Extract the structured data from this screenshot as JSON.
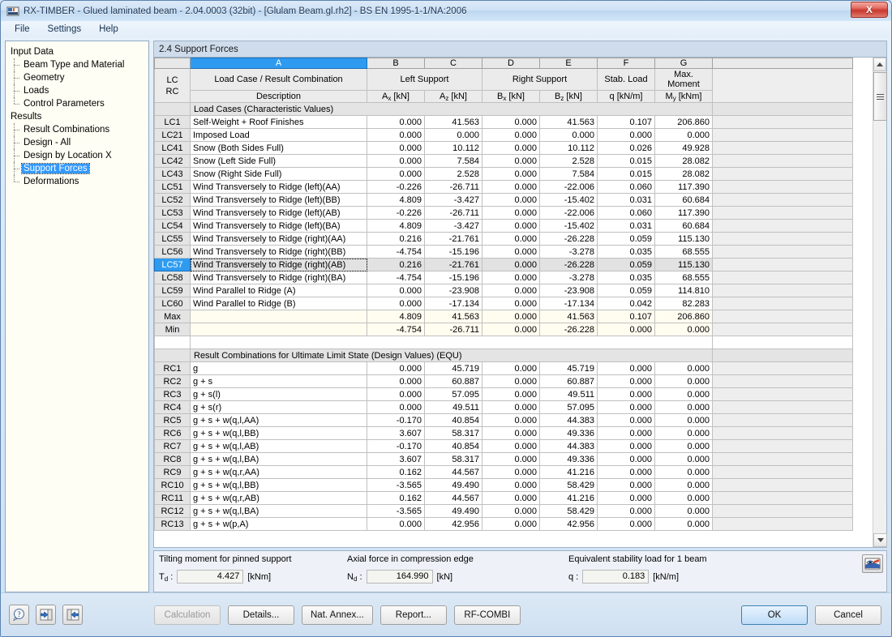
{
  "window": {
    "title": "RX-TIMBER - Glued laminated beam - 2.04.0003 (32bit) - [Glulam Beam.gl.rh2] - BS EN 1995-1-1/NA:2006",
    "close_label": "X"
  },
  "menubar": {
    "items": [
      "File",
      "Settings",
      "Help"
    ]
  },
  "sidebar": {
    "groups": [
      {
        "label": "Input Data",
        "children": [
          {
            "label": "Beam Type and Material",
            "selected": false
          },
          {
            "label": "Geometry",
            "selected": false
          },
          {
            "label": "Loads",
            "selected": false
          },
          {
            "label": "Control Parameters",
            "selected": false
          }
        ]
      },
      {
        "label": "Results",
        "children": [
          {
            "label": "Result Combinations",
            "selected": false
          },
          {
            "label": "Design - All",
            "selected": false
          },
          {
            "label": "Design by Location X",
            "selected": false
          },
          {
            "label": "Support Forces",
            "selected": true
          },
          {
            "label": "Deformations",
            "selected": false
          }
        ]
      }
    ]
  },
  "panel": {
    "header": "2.4 Support Forces"
  },
  "table": {
    "column_letters": [
      "",
      "A",
      "B",
      "C",
      "D",
      "E",
      "F",
      "G",
      ""
    ],
    "selected_column_letter": "A",
    "corner_header": {
      "line1": "LC",
      "line2": "RC"
    },
    "headers": [
      {
        "group": "Load Case / Result Combination",
        "unit": "Description"
      },
      {
        "group": "Left Support",
        "unit": "A<sub>x</sub> [kN]"
      },
      {
        "group": "",
        "unit": "A<sub>z</sub> [kN]"
      },
      {
        "group": "Right Support",
        "unit": "B<sub>x</sub> [kN]"
      },
      {
        "group": "",
        "unit": "B<sub>z</sub> [kN]"
      },
      {
        "group": "Stab. Load",
        "unit": "q [kN/m]"
      },
      {
        "group": "Max. Moment",
        "unit": "M<sub>y</sub> [kNm]"
      }
    ],
    "section1_title": "Load Cases (Characteristic Values)",
    "section2_title": "Result Combinations for Ultimate Limit State (Design Values) (EQU)",
    "selected_row_id": "LC57",
    "load_cases": [
      {
        "id": "LC1",
        "desc": "Self-Weight + Roof Finishes",
        "ax": "0.000",
        "az": "41.563",
        "bx": "0.000",
        "bz": "41.563",
        "q": "0.107",
        "my": "206.860"
      },
      {
        "id": "LC21",
        "desc": "Imposed Load",
        "ax": "0.000",
        "az": "0.000",
        "bx": "0.000",
        "bz": "0.000",
        "q": "0.000",
        "my": "0.000"
      },
      {
        "id": "LC41",
        "desc": "Snow (Both Sides Full)",
        "ax": "0.000",
        "az": "10.112",
        "bx": "0.000",
        "bz": "10.112",
        "q": "0.026",
        "my": "49.928"
      },
      {
        "id": "LC42",
        "desc": "Snow (Left Side Full)",
        "ax": "0.000",
        "az": "7.584",
        "bx": "0.000",
        "bz": "2.528",
        "q": "0.015",
        "my": "28.082"
      },
      {
        "id": "LC43",
        "desc": "Snow (Right Side Full)",
        "ax": "0.000",
        "az": "2.528",
        "bx": "0.000",
        "bz": "7.584",
        "q": "0.015",
        "my": "28.082"
      },
      {
        "id": "LC51",
        "desc": "Wind Transversely to Ridge (left)(AA)",
        "ax": "-0.226",
        "az": "-26.711",
        "bx": "0.000",
        "bz": "-22.006",
        "q": "0.060",
        "my": "117.390"
      },
      {
        "id": "LC52",
        "desc": "Wind Transversely to Ridge (left)(BB)",
        "ax": "4.809",
        "az": "-3.427",
        "bx": "0.000",
        "bz": "-15.402",
        "q": "0.031",
        "my": "60.684"
      },
      {
        "id": "LC53",
        "desc": "Wind Transversely to Ridge (left)(AB)",
        "ax": "-0.226",
        "az": "-26.711",
        "bx": "0.000",
        "bz": "-22.006",
        "q": "0.060",
        "my": "117.390"
      },
      {
        "id": "LC54",
        "desc": "Wind Transversely to Ridge (left)(BA)",
        "ax": "4.809",
        "az": "-3.427",
        "bx": "0.000",
        "bz": "-15.402",
        "q": "0.031",
        "my": "60.684"
      },
      {
        "id": "LC55",
        "desc": "Wind Transversely to Ridge (right)(AA)",
        "ax": "0.216",
        "az": "-21.761",
        "bx": "0.000",
        "bz": "-26.228",
        "q": "0.059",
        "my": "115.130"
      },
      {
        "id": "LC56",
        "desc": "Wind Transversely to Ridge (right)(BB)",
        "ax": "-4.754",
        "az": "-15.196",
        "bx": "0.000",
        "bz": "-3.278",
        "q": "0.035",
        "my": "68.555"
      },
      {
        "id": "LC57",
        "desc": "Wind Transversely to Ridge (right)(AB)",
        "ax": "0.216",
        "az": "-21.761",
        "bx": "0.000",
        "bz": "-26.228",
        "q": "0.059",
        "my": "115.130"
      },
      {
        "id": "LC58",
        "desc": "Wind Transversely to Ridge (right)(BA)",
        "ax": "-4.754",
        "az": "-15.196",
        "bx": "0.000",
        "bz": "-3.278",
        "q": "0.035",
        "my": "68.555"
      },
      {
        "id": "LC59",
        "desc": "Wind Parallel to Ridge (A)",
        "ax": "0.000",
        "az": "-23.908",
        "bx": "0.000",
        "bz": "-23.908",
        "q": "0.059",
        "my": "114.810"
      },
      {
        "id": "LC60",
        "desc": "Wind Parallel to Ridge (B)",
        "ax": "0.000",
        "az": "-17.134",
        "bx": "0.000",
        "bz": "-17.134",
        "q": "0.042",
        "my": "82.283"
      }
    ],
    "summary": [
      {
        "id": "Max",
        "desc": "",
        "ax": "4.809",
        "az": "41.563",
        "bx": "0.000",
        "bz": "41.563",
        "q": "0.107",
        "my": "206.860"
      },
      {
        "id": "Min",
        "desc": "",
        "ax": "-4.754",
        "az": "-26.711",
        "bx": "0.000",
        "bz": "-26.228",
        "q": "0.000",
        "my": "0.000"
      }
    ],
    "result_combinations": [
      {
        "id": "RC1",
        "desc": "g",
        "ax": "0.000",
        "az": "45.719",
        "bx": "0.000",
        "bz": "45.719",
        "q": "0.000",
        "my": "0.000"
      },
      {
        "id": "RC2",
        "desc": "g + s",
        "ax": "0.000",
        "az": "60.887",
        "bx": "0.000",
        "bz": "60.887",
        "q": "0.000",
        "my": "0.000"
      },
      {
        "id": "RC3",
        "desc": "g + s(l)",
        "ax": "0.000",
        "az": "57.095",
        "bx": "0.000",
        "bz": "49.511",
        "q": "0.000",
        "my": "0.000"
      },
      {
        "id": "RC4",
        "desc": "g + s(r)",
        "ax": "0.000",
        "az": "49.511",
        "bx": "0.000",
        "bz": "57.095",
        "q": "0.000",
        "my": "0.000"
      },
      {
        "id": "RC5",
        "desc": "g + s + w(q,l,AA)",
        "ax": "-0.170",
        "az": "40.854",
        "bx": "0.000",
        "bz": "44.383",
        "q": "0.000",
        "my": "0.000"
      },
      {
        "id": "RC6",
        "desc": "g + s + w(q,l,BB)",
        "ax": "3.607",
        "az": "58.317",
        "bx": "0.000",
        "bz": "49.336",
        "q": "0.000",
        "my": "0.000"
      },
      {
        "id": "RC7",
        "desc": "g + s + w(q,l,AB)",
        "ax": "-0.170",
        "az": "40.854",
        "bx": "0.000",
        "bz": "44.383",
        "q": "0.000",
        "my": "0.000"
      },
      {
        "id": "RC8",
        "desc": "g + s + w(q,l,BA)",
        "ax": "3.607",
        "az": "58.317",
        "bx": "0.000",
        "bz": "49.336",
        "q": "0.000",
        "my": "0.000"
      },
      {
        "id": "RC9",
        "desc": "g + s + w(q,r,AA)",
        "ax": "0.162",
        "az": "44.567",
        "bx": "0.000",
        "bz": "41.216",
        "q": "0.000",
        "my": "0.000"
      },
      {
        "id": "RC10",
        "desc": "g + s + w(q,l,BB)",
        "ax": "-3.565",
        "az": "49.490",
        "bx": "0.000",
        "bz": "58.429",
        "q": "0.000",
        "my": "0.000"
      },
      {
        "id": "RC11",
        "desc": "g + s + w(q,r,AB)",
        "ax": "0.162",
        "az": "44.567",
        "bx": "0.000",
        "bz": "41.216",
        "q": "0.000",
        "my": "0.000"
      },
      {
        "id": "RC12",
        "desc": "g + s + w(q,l,BA)",
        "ax": "-3.565",
        "az": "49.490",
        "bx": "0.000",
        "bz": "58.429",
        "q": "0.000",
        "my": "0.000"
      },
      {
        "id": "RC13",
        "desc": "g + s + w(p,A)",
        "ax": "0.000",
        "az": "42.956",
        "bx": "0.000",
        "bz": "42.956",
        "q": "0.000",
        "my": "0.000"
      }
    ]
  },
  "info": {
    "fields": [
      {
        "caption": "Tilting moment for pinned support",
        "symbol": "T",
        "sub": "d",
        "value": "4.427",
        "unit": "[kNm]"
      },
      {
        "caption": "Axial force in compression edge",
        "symbol": "N",
        "sub": "d",
        "value": "164.990",
        "unit": "[kN]"
      },
      {
        "caption": "Equivalent stability load for 1 beam",
        "symbol": "q",
        "sub": "",
        "value": "0.183",
        "unit": "[kN/m]"
      }
    ],
    "view_button_icon": "eye-view-icon"
  },
  "footer": {
    "left_icons": [
      "help-question-icon",
      "back-arrow-icon",
      "forward-arrow-icon"
    ],
    "buttons": [
      {
        "label": "Calculation",
        "disabled": true
      },
      {
        "label": "Details...",
        "disabled": false
      },
      {
        "label": "Nat. Annex...",
        "disabled": false
      },
      {
        "label": "Report...",
        "disabled": false
      },
      {
        "label": "RF-COMBI",
        "disabled": false
      }
    ],
    "ok_label": "OK",
    "cancel_label": "Cancel"
  },
  "colors": {
    "accent": "#2e9bf0",
    "title_close": "#c9382e",
    "header_bg": "#ebebeb",
    "minmax_bg": "#fffdf0"
  }
}
